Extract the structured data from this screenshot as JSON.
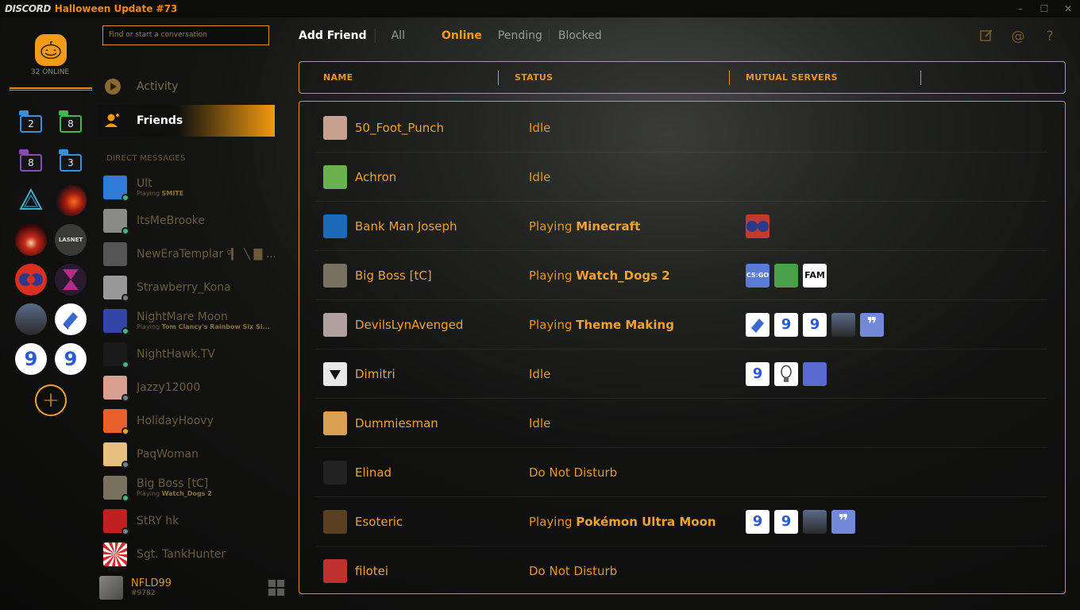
{
  "window": {
    "brand": "DISCORD",
    "title": "Halloween Update #73",
    "controls": [
      "–",
      "☐",
      "✕"
    ]
  },
  "servers": {
    "online_count": "32 ONLINE",
    "folders": [
      {
        "count": "2",
        "color": "#3a8fdc"
      },
      {
        "count": "8",
        "color": "#3fb850"
      },
      {
        "count": "8",
        "color": "#8a4ab8"
      },
      {
        "count": "3",
        "color": "#3a8fdc"
      }
    ],
    "add_label": "+"
  },
  "channels": {
    "search_placeholder": "Find or start a conversation",
    "nav": [
      {
        "label": "Activity"
      },
      {
        "label": "Friends"
      }
    ],
    "dm_header": "DIRECT MESSAGES",
    "dms": [
      {
        "name": "Ult",
        "sub_prefix": "Playing ",
        "sub_game": "SMITE",
        "status": "#43b581",
        "avatar": "#2f7bd6"
      },
      {
        "name": "ItsMeBrooke",
        "sub_prefix": "",
        "sub_game": "",
        "status": "#43b581",
        "avatar": "#8a8a88"
      },
      {
        "name": "NewEraTemplar ᵍ▎ ╲ ▇ ...",
        "sub_prefix": "",
        "sub_game": "",
        "status": "",
        "avatar": "#555555"
      },
      {
        "name": "Strawberry_Kona",
        "sub_prefix": "",
        "sub_game": "",
        "status": "#747f8d",
        "avatar": "#999999"
      },
      {
        "name": "NightMare Moon",
        "sub_prefix": "Playing ",
        "sub_game": "Tom Clancy's Rainbow Six Si...",
        "status": "#43b581",
        "avatar": "#3346a8"
      },
      {
        "name": "NightHawk.TV",
        "sub_prefix": "",
        "sub_game": "",
        "status": "#43b581",
        "avatar": "#1a1a1a"
      },
      {
        "name": "Jazzy12000",
        "sub_prefix": "",
        "sub_game": "",
        "status": "#747f8d",
        "avatar": "#d9a090"
      },
      {
        "name": "HolidayHoovy",
        "sub_prefix": "",
        "sub_game": "",
        "status": "#faa61a",
        "avatar": "#e8602c"
      },
      {
        "name": "PaqWoman",
        "sub_prefix": "",
        "sub_game": "",
        "status": "#747f8d",
        "avatar": "#e8c080"
      },
      {
        "name": "Big Boss [tC]",
        "sub_prefix": "Playing ",
        "sub_game": "Watch_Dogs 2",
        "status": "#43b581",
        "avatar": "#7a7060"
      },
      {
        "name": "StRY hk",
        "sub_prefix": "",
        "sub_game": "",
        "status": "#747f8d",
        "avatar": "#c02020"
      },
      {
        "name": "Sgt. TankHunter",
        "sub_prefix": "",
        "sub_game": "",
        "status": "",
        "avatar": "#d82828"
      }
    ],
    "user": {
      "name": "NFLD99",
      "tag": "#9782"
    }
  },
  "topbar": {
    "tabs": [
      "Add Friend",
      "All",
      "Online",
      "Pending",
      "Blocked"
    ],
    "icons": [
      "new-dm-icon",
      "mentions-icon",
      "help-icon"
    ]
  },
  "table": {
    "headers": [
      "NAME",
      "STATUS",
      "MUTUAL SERVERS"
    ],
    "rows": [
      {
        "name": "50_Foot_Punch",
        "status_prefix": "Idle",
        "status_game": "",
        "avatar": "#c8a090",
        "mutuals": []
      },
      {
        "name": "Achron",
        "status_prefix": "Idle",
        "status_game": "",
        "avatar": "#6ab04c",
        "mutuals": []
      },
      {
        "name": "Bank Man Joseph",
        "status_prefix": "Playing ",
        "status_game": "Minecraft",
        "avatar": "#1a6ab8",
        "mutuals": [
          {
            "bg": "#c23a2a",
            "text": ""
          }
        ]
      },
      {
        "name": "Big Boss [tC]",
        "status_prefix": "Playing ",
        "status_game": "Watch_Dogs 2",
        "avatar": "#7a7060",
        "mutuals": [
          {
            "bg": "#5a7ad8",
            "text": "CS:GO"
          },
          {
            "bg": "#4aa04a",
            "text": ""
          },
          {
            "bg": "#ffffff",
            "text": "FAM"
          }
        ]
      },
      {
        "name": "DevilsLynAvenged",
        "status_prefix": "Playing ",
        "status_game": "Theme Making",
        "avatar": "#b0a0a0",
        "mutuals": [
          {
            "bg": "#ffffff",
            "text": ""
          },
          {
            "bg": "#ffffff",
            "text": "9"
          },
          {
            "bg": "#ffffff",
            "text": "9"
          },
          {
            "bg": "#3a3a3a",
            "text": ""
          },
          {
            "bg": "#7289da",
            "text": "❞"
          }
        ]
      },
      {
        "name": "Dimitri",
        "status_prefix": "Idle",
        "status_game": "",
        "avatar": "#e8e8e8",
        "mutuals": [
          {
            "bg": "#ffffff",
            "text": "9"
          },
          {
            "bg": "#ffffff",
            "text": ""
          },
          {
            "bg": "#5a6ad0",
            "text": ""
          }
        ]
      },
      {
        "name": "Dummiesman",
        "status_prefix": "Idle",
        "status_game": "",
        "avatar": "#d8a050",
        "mutuals": []
      },
      {
        "name": "Elinad",
        "status_prefix": "Do Not Disturb",
        "status_game": "",
        "avatar": "#222222",
        "mutuals": []
      },
      {
        "name": "Esoteric",
        "status_prefix": "Playing ",
        "status_game": "Pokémon Ultra Moon",
        "avatar": "#5a4020",
        "mutuals": [
          {
            "bg": "#ffffff",
            "text": "9"
          },
          {
            "bg": "#ffffff",
            "text": "9"
          },
          {
            "bg": "#3a3a3a",
            "text": ""
          },
          {
            "bg": "#7289da",
            "text": "❞"
          }
        ]
      },
      {
        "name": "filotei",
        "status_prefix": "Do Not Disturb",
        "status_game": "",
        "avatar": "#c03030",
        "mutuals": []
      }
    ]
  },
  "colors": {
    "accent": "#f29a10",
    "border": "#e6901c"
  }
}
